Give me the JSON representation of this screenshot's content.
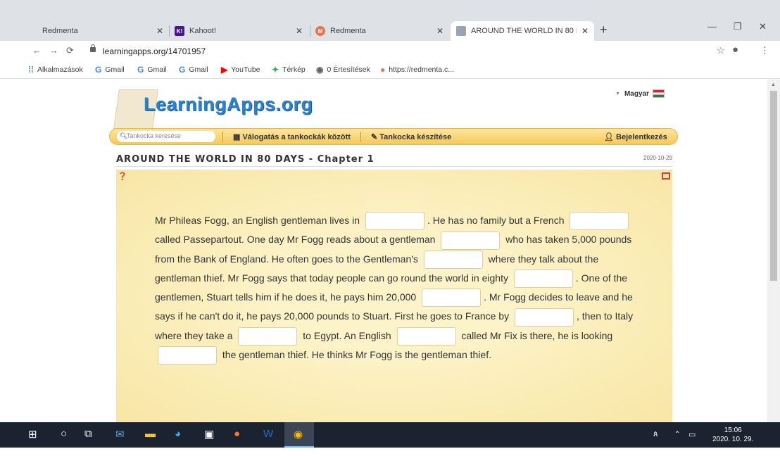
{
  "browser": {
    "tabs": [
      {
        "title": "Redmenta",
        "favicon_color": "#e8754b"
      },
      {
        "title": "Kahoot!",
        "favicon_glyph": "K!",
        "favicon_color": "#46178f"
      },
      {
        "title": "Redmenta",
        "favicon_color": "#e8754b"
      },
      {
        "title": "AROUND THE WORLD IN 80 DAYS - Chapter 1",
        "active": true
      }
    ],
    "url": "learningapps.org/14701957",
    "bookmarks": [
      {
        "label": "Alkalmazások",
        "icon": "apps-grid-icon"
      },
      {
        "label": "Gmail",
        "icon": "google-icon"
      },
      {
        "label": "Gmail",
        "icon": "google-icon"
      },
      {
        "label": "Gmail",
        "icon": "google-icon"
      },
      {
        "label": "YouTube",
        "icon": "youtube-icon"
      },
      {
        "label": "Térkép",
        "icon": "maps-icon"
      },
      {
        "label": "0 Értesítések",
        "icon": "notification-icon"
      },
      {
        "label": "https://redmenta.c...",
        "icon": "redmenta-icon"
      }
    ]
  },
  "site": {
    "logo": "LearningApps.org",
    "language": "Magyar",
    "search_placeholder": "Tankocka keresése",
    "nav": {
      "browse": "Válogatás a tankockák között",
      "create": "Tankocka készítése",
      "login": "Bejelentkezés"
    },
    "app_title": "AROUND THE WORLD IN 80 DAYS - Chapter 1",
    "app_date": "2020-10-29"
  },
  "exercise": {
    "segments": [
      "Mr Phileas Fogg, an English gentleman lives in ",
      ". He has no family but a French ",
      " called Passepartout. One day Mr Fogg reads about a gentleman ",
      " who has taken 5,000 pounds from the Bank of England. He often goes to the Gentleman's ",
      " where they talk about the gentleman thief. Mr Fogg says that today people can go round the world in eighty ",
      ". One of the gentlemen, Stuart tells him if he does it, he pays him 20,000 ",
      ". Mr Fogg decides to leave and he says if he can't do it, he pays 20,000 pounds to Stuart. First he goes to France by ",
      ", then to Italy where they take a ",
      " to Egypt. An English ",
      " called Mr Fix is there, he is looking ",
      " the gentleman thief. He thinks Mr Fogg is the gentleman thief."
    ]
  },
  "taskbar": {
    "time": "15:06",
    "date": "2020. 10. 29."
  }
}
